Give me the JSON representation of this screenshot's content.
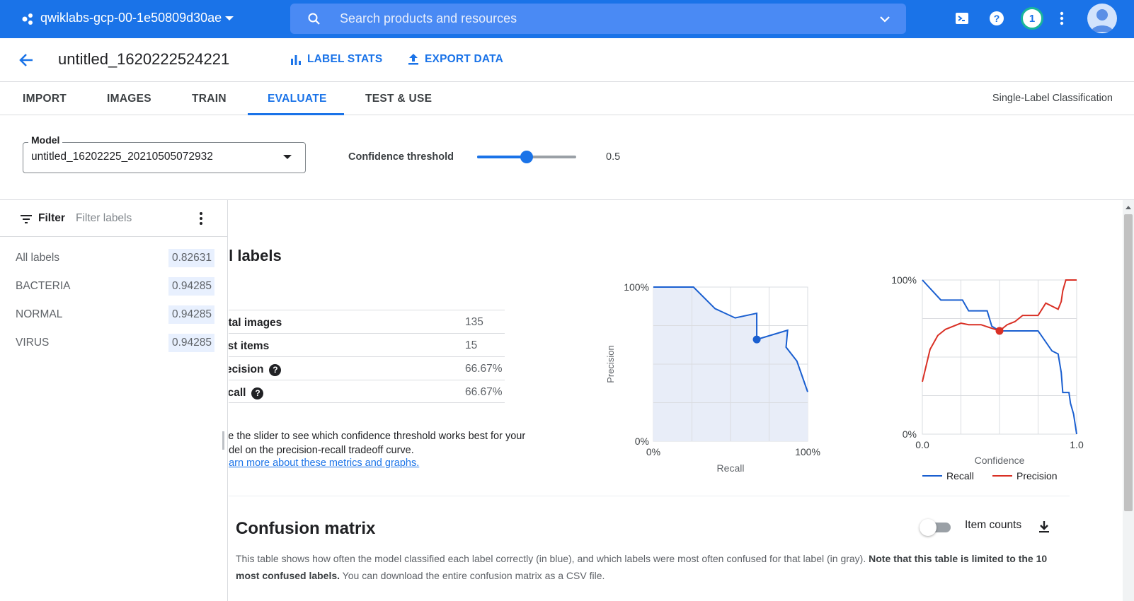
{
  "topbar": {
    "project": "qwiklabs-gcp-00-1e50809d30ae",
    "search_placeholder": "Search products and resources",
    "notification_count": "1"
  },
  "header": {
    "title": "untitled_1620222524221",
    "actions": [
      "LABEL STATS",
      "EXPORT DATA"
    ]
  },
  "tabs": [
    "IMPORT",
    "IMAGES",
    "TRAIN",
    "EVALUATE",
    "TEST & USE"
  ],
  "active_tab": "EVALUATE",
  "mode": "Single-Label Classification",
  "model_select": {
    "label": "Model",
    "value": "untitled_16202225_20210505072932"
  },
  "confidence": {
    "label": "Confidence threshold",
    "value": "0.5",
    "fraction": 0.5
  },
  "filter": {
    "label": "Filter",
    "placeholder": "Filter labels"
  },
  "labels": [
    {
      "name": "All labels",
      "value": "0.82631"
    },
    {
      "name": "BACTERIA",
      "value": "0.94285"
    },
    {
      "name": "NORMAL",
      "value": "0.94285"
    },
    {
      "name": "VIRUS",
      "value": "0.94285"
    }
  ],
  "section_title": "ll labels",
  "metrics": [
    {
      "key": "otal images",
      "value": "135",
      "help": false
    },
    {
      "key": "est items",
      "value": "15",
      "help": false
    },
    {
      "key": "recision",
      "value": "66.67%",
      "help": true
    },
    {
      "key": "ecall",
      "value": "66.67%",
      "help": true
    }
  ],
  "hint_text": "se the slider to see which confidence threshold works best for your odel on the precision-recall tradeoff curve.",
  "hint_line1": "se the slider to see which confidence threshold works best for your",
  "hint_line2": "odel on the precision-recall tradeoff curve.",
  "hint_link": "earn more about these metrics and graphs.",
  "colors": {
    "brand": "#1a73e8",
    "recall": "#1a5fd0",
    "precision": "#d93025"
  },
  "chart_data": [
    {
      "type": "line",
      "xlabel": "Recall",
      "ylabel": "Precision",
      "xlim": [
        0,
        100
      ],
      "ylim": [
        0,
        100
      ],
      "x_ticks": [
        "0%",
        "100%"
      ],
      "y_ticks": [
        "0%",
        "100%"
      ],
      "area": true,
      "series": [
        {
          "x": [
            0,
            26,
            40,
            53,
            67,
            67,
            87,
            86,
            93,
            100
          ],
          "y": [
            100,
            100,
            86,
            80,
            83,
            66,
            72,
            61,
            52,
            32
          ]
        }
      ],
      "marker": {
        "x": 67,
        "y": 66
      }
    },
    {
      "type": "line",
      "xlabel": "Confidence",
      "xlim": [
        0,
        1
      ],
      "ylim": [
        0,
        100
      ],
      "x_ticks": [
        "0.0",
        "1.0"
      ],
      "y_ticks": [
        "0%",
        "100%"
      ],
      "series": [
        {
          "name": "Recall",
          "x": [
            0,
            0.12,
            0.26,
            0.3,
            0.42,
            0.45,
            0.5,
            0.75,
            0.84,
            0.88,
            0.9,
            0.91,
            0.92,
            0.95,
            0.96,
            0.98,
            1.0
          ],
          "y": [
            100,
            87,
            87,
            80,
            80,
            70,
            67,
            67,
            54,
            52,
            40,
            27,
            27,
            27,
            20,
            13,
            0
          ]
        },
        {
          "name": "Precision",
          "x": [
            0,
            0.05,
            0.1,
            0.15,
            0.25,
            0.3,
            0.38,
            0.5,
            0.55,
            0.6,
            0.65,
            0.75,
            0.8,
            0.88,
            0.9,
            0.91,
            0.93,
            1.0
          ],
          "y": [
            34,
            55,
            64,
            68,
            72,
            71,
            71,
            67,
            71,
            73,
            77,
            77,
            85,
            81,
            86,
            93,
            100,
            100
          ]
        }
      ],
      "marker": {
        "x": 0.5,
        "y": 67
      },
      "legend": "bottom"
    }
  ],
  "confusion_matrix": {
    "title": "Confusion matrix",
    "toggle_label": "Item counts",
    "desc_1": "This table shows how often the model classified each label correctly (in blue), and which labels were most often confused for that label (in gray). ",
    "desc_bold": "Note that this table is limited to the 10 most confused labels.",
    "desc_2": " You can download the entire confusion matrix as a CSV file."
  }
}
